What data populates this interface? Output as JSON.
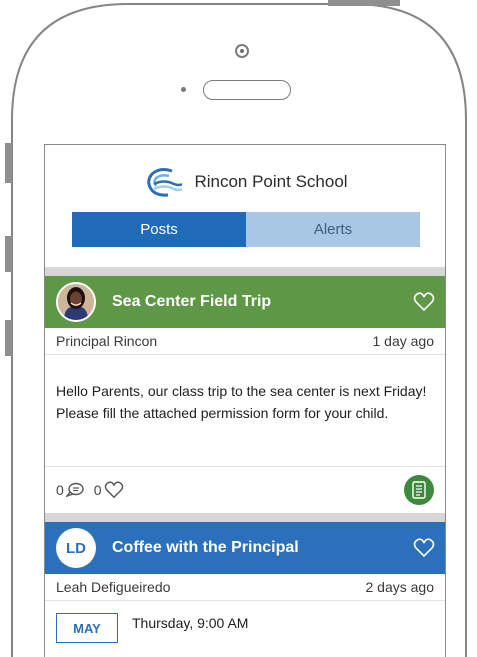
{
  "app": {
    "school_name": "Rincon Point School"
  },
  "tabs": [
    {
      "label": "Posts",
      "active": true
    },
    {
      "label": "Alerts",
      "active": false
    }
  ],
  "posts": [
    {
      "title": "Sea Center Field Trip",
      "author": "Principal Rincon",
      "time": "1 day ago",
      "body": "Hello Parents, our class trip to the sea center is next Friday! Please fill the attached permission form for your child.",
      "comments": "0",
      "likes": "0",
      "color": "#5e9746",
      "avatar_icon": "principal-photo"
    },
    {
      "title": "Coffee with the Principal",
      "initials": "LD",
      "author": "Leah Defigueiredo",
      "time": "2 days ago",
      "event_month": "MAY",
      "event_time": "Thursday, 9:00 AM",
      "color": "#2a70bb"
    }
  ],
  "colors": {
    "tab_active": "#1f6bb8",
    "tab_inactive": "#a7c7e5",
    "attachment_button": "#3e8a3c"
  },
  "icons": {
    "logo": "wave-logo-icon",
    "like": "heart-outline-icon",
    "comment": "speech-bubble-icon",
    "attachment": "form-document-icon"
  }
}
